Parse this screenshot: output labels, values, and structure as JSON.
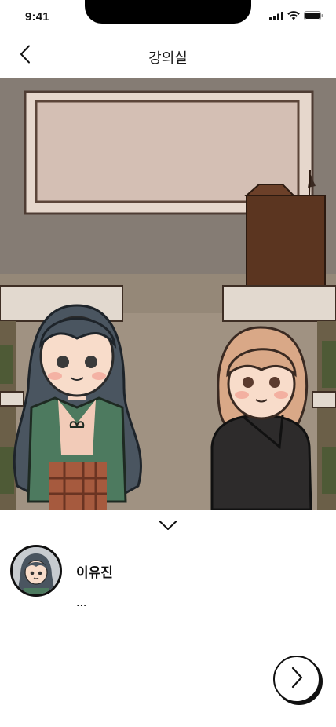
{
  "status_bar": {
    "time": "9:41",
    "icons": [
      "signal-icon",
      "wifi-icon",
      "battery-icon"
    ]
  },
  "nav": {
    "title": "강의실",
    "back_icon": "chevron-left-icon"
  },
  "scene": {
    "image": "classroom-illustration-two-characters"
  },
  "dialogue": {
    "collapse_icon": "chevron-down-icon",
    "speaker_name": "이유진",
    "text": "...",
    "next_icon": "chevron-right-icon"
  },
  "colors": {
    "background": "#ffffff",
    "text": "#111111",
    "accent": "#111111"
  }
}
